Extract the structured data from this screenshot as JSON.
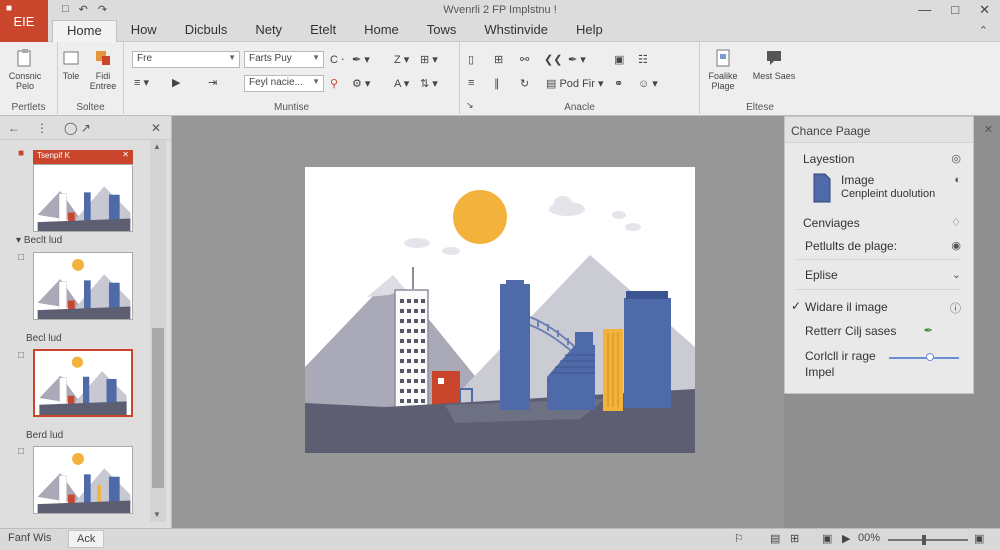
{
  "titlebar": {
    "file_label": "EIE",
    "title": "Wvenrli 2 FP Implstnu !",
    "quick_access": [
      "save-icon",
      "undo-icon",
      "redo-icon"
    ],
    "window_controls": [
      "minimize-icon",
      "maximize-icon",
      "close-icon"
    ]
  },
  "tabs": [
    "Home",
    "How",
    "Dicbuls",
    "Nety",
    "Etelt",
    "Home",
    "Tows",
    "Whstinvide",
    "Help"
  ],
  "active_tab": "Home",
  "ribbon": {
    "groups": [
      {
        "label": "Pertlets",
        "buttons": [
          "Consnic Pelo",
          "Tole"
        ]
      },
      {
        "label": "Soltee",
        "buttons": [
          "Fidi Entree"
        ]
      },
      {
        "label": "Muntise",
        "combos": [
          "Fre",
          "Farts Puy",
          "Feyl nacie..."
        ]
      },
      {
        "label": "Anacle",
        "buttons": [
          "Pod Fir"
        ]
      },
      {
        "label": "Eltese",
        "buttons": [
          "Foalike Plage",
          "Mest Saes"
        ]
      }
    ],
    "font_size_a": "Z",
    "font_size_b": "A"
  },
  "thumbs_pane": {
    "tooltip": "Tsenpif K",
    "sections": [
      "Beclt lud",
      "Becl lud",
      "Berd lud"
    ],
    "slide_count": 4,
    "selected_index": 2
  },
  "right_pane": {
    "title": "Chance Paage",
    "rows": [
      {
        "label": "Layestion",
        "end": "◎"
      },
      {
        "label": "Image",
        "sub": "Cenpleint duolution",
        "end": "◐"
      },
      {
        "label": "Cenviages",
        "end": "♢"
      },
      {
        "label": "Petlults de plage:",
        "end": "◉"
      },
      {
        "label": "Eplise",
        "end": "⌄"
      },
      {
        "label": "Widare il image",
        "end": "ⓘ",
        "checked": true
      },
      {
        "label": "Retterr Cilj sases",
        "end": "✒"
      },
      {
        "label": "Corlcll ir rage",
        "sub": "Impel",
        "slider_value": 0.6
      }
    ]
  },
  "status": {
    "left": "Fanf Wis",
    "tab": "Ack",
    "zoom": "00%",
    "zoom_value": 0.45
  },
  "colors": {
    "accent": "#c9452c",
    "sun": "#f2b23b",
    "building_blue": "#4f6aa8",
    "building_yellow": "#f2b23b",
    "mountain": "#a9a9b8",
    "ground": "#5d5e72"
  }
}
